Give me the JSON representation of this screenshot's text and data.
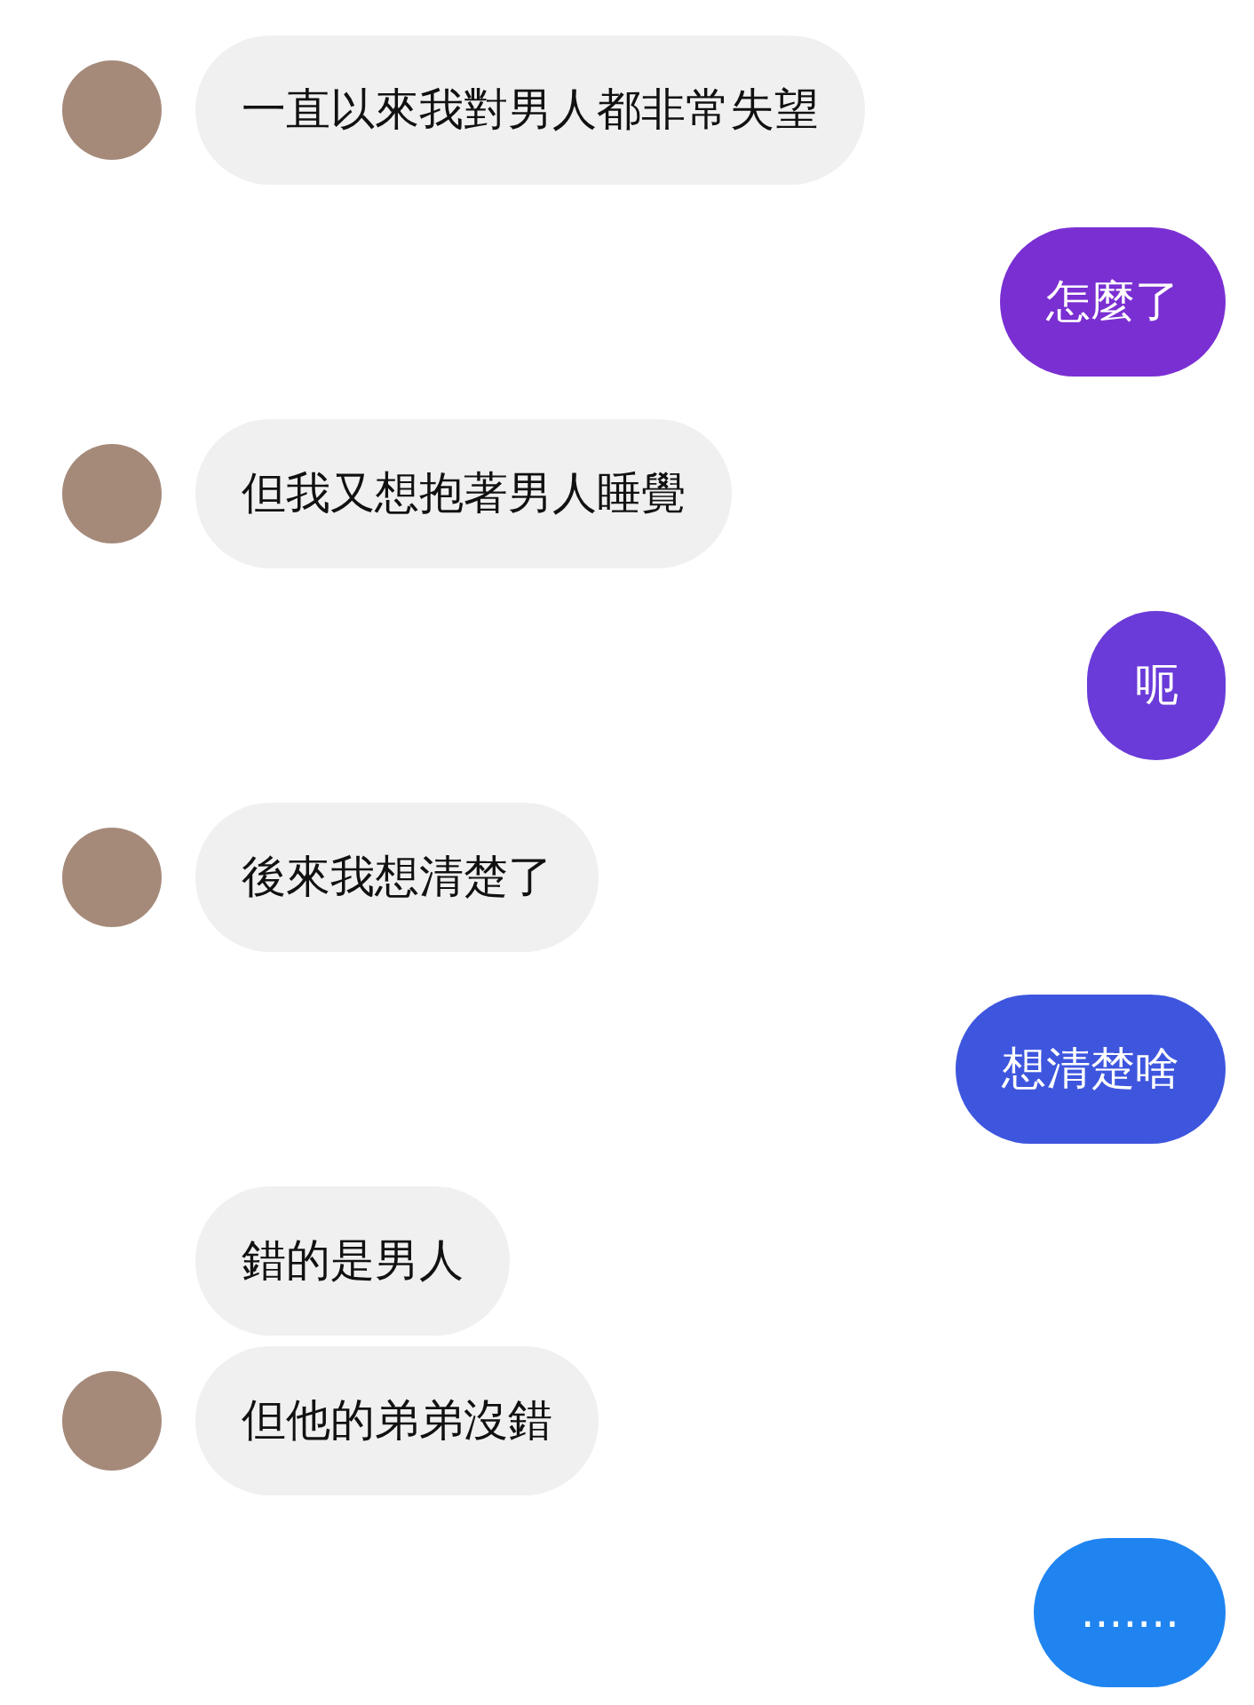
{
  "messages": [
    {
      "kind": "received",
      "text": "一直以來我對男人都非常失望",
      "avatar": true
    },
    {
      "kind": "sent",
      "text": "怎麼了",
      "color": "#7a2fd2"
    },
    {
      "kind": "received",
      "text": "但我又想抱著男人睡覺",
      "avatar": true
    },
    {
      "kind": "sent",
      "text": "呃",
      "color": "#6a3bd8"
    },
    {
      "kind": "received",
      "text": "後來我想清楚了",
      "avatar": true
    },
    {
      "kind": "sent",
      "text": "想清楚啥",
      "color": "#3e56de"
    },
    {
      "kind": "received",
      "text": "錯的是男人",
      "avatar": false
    },
    {
      "kind": "received",
      "text": "但他的弟弟沒錯",
      "avatar": true
    },
    {
      "kind": "sent",
      "text": ".......",
      "color": "#1f84f0"
    }
  ]
}
